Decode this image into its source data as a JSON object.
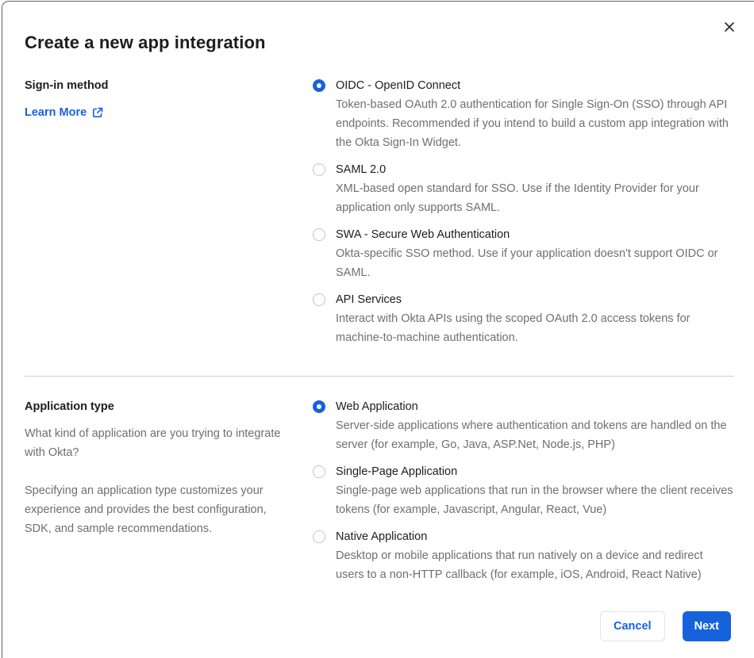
{
  "dialog": {
    "title": "Create a new app integration"
  },
  "signin_section": {
    "label": "Sign-in method",
    "learn_more_label": "Learn More",
    "options": [
      {
        "label": "OIDC - OpenID Connect",
        "description": "Token-based OAuth 2.0 authentication for Single Sign-On (SSO) through API endpoints. Recommended if you intend to build a custom app integration with the Okta Sign-In Widget.",
        "selected": true
      },
      {
        "label": "SAML 2.0",
        "description": "XML-based open standard for SSO. Use if the Identity Provider for your application only supports SAML.",
        "selected": false
      },
      {
        "label": "SWA - Secure Web Authentication",
        "description": "Okta-specific SSO method. Use if your application doesn't support OIDC or SAML.",
        "selected": false
      },
      {
        "label": "API Services",
        "description": "Interact with Okta APIs using the scoped OAuth 2.0 access tokens for machine-to-machine authentication.",
        "selected": false
      }
    ]
  },
  "apptype_section": {
    "label": "Application type",
    "paragraph1": "What kind of application are you trying to integrate with Okta?",
    "paragraph2": "Specifying an application type customizes your experience and provides the best configuration, SDK, and sample recommendations.",
    "options": [
      {
        "label": "Web Application",
        "description": "Server-side applications where authentication and tokens are handled on the server (for example, Go, Java, ASP.Net, Node.js, PHP)",
        "selected": true
      },
      {
        "label": "Single-Page Application",
        "description": "Single-page web applications that run in the browser where the client receives tokens (for example, Javascript, Angular, React, Vue)",
        "selected": false
      },
      {
        "label": "Native Application",
        "description": "Desktop or mobile applications that run natively on a device and redirect users to a non-HTTP callback (for example, iOS, Android, React Native)",
        "selected": false
      }
    ]
  },
  "footer": {
    "cancel_label": "Cancel",
    "next_label": "Next"
  },
  "colors": {
    "accent_blue": "#1662dd",
    "text_dark": "#1d1d21",
    "text_muted": "#6e6e78",
    "divider": "#cfcfd4"
  }
}
